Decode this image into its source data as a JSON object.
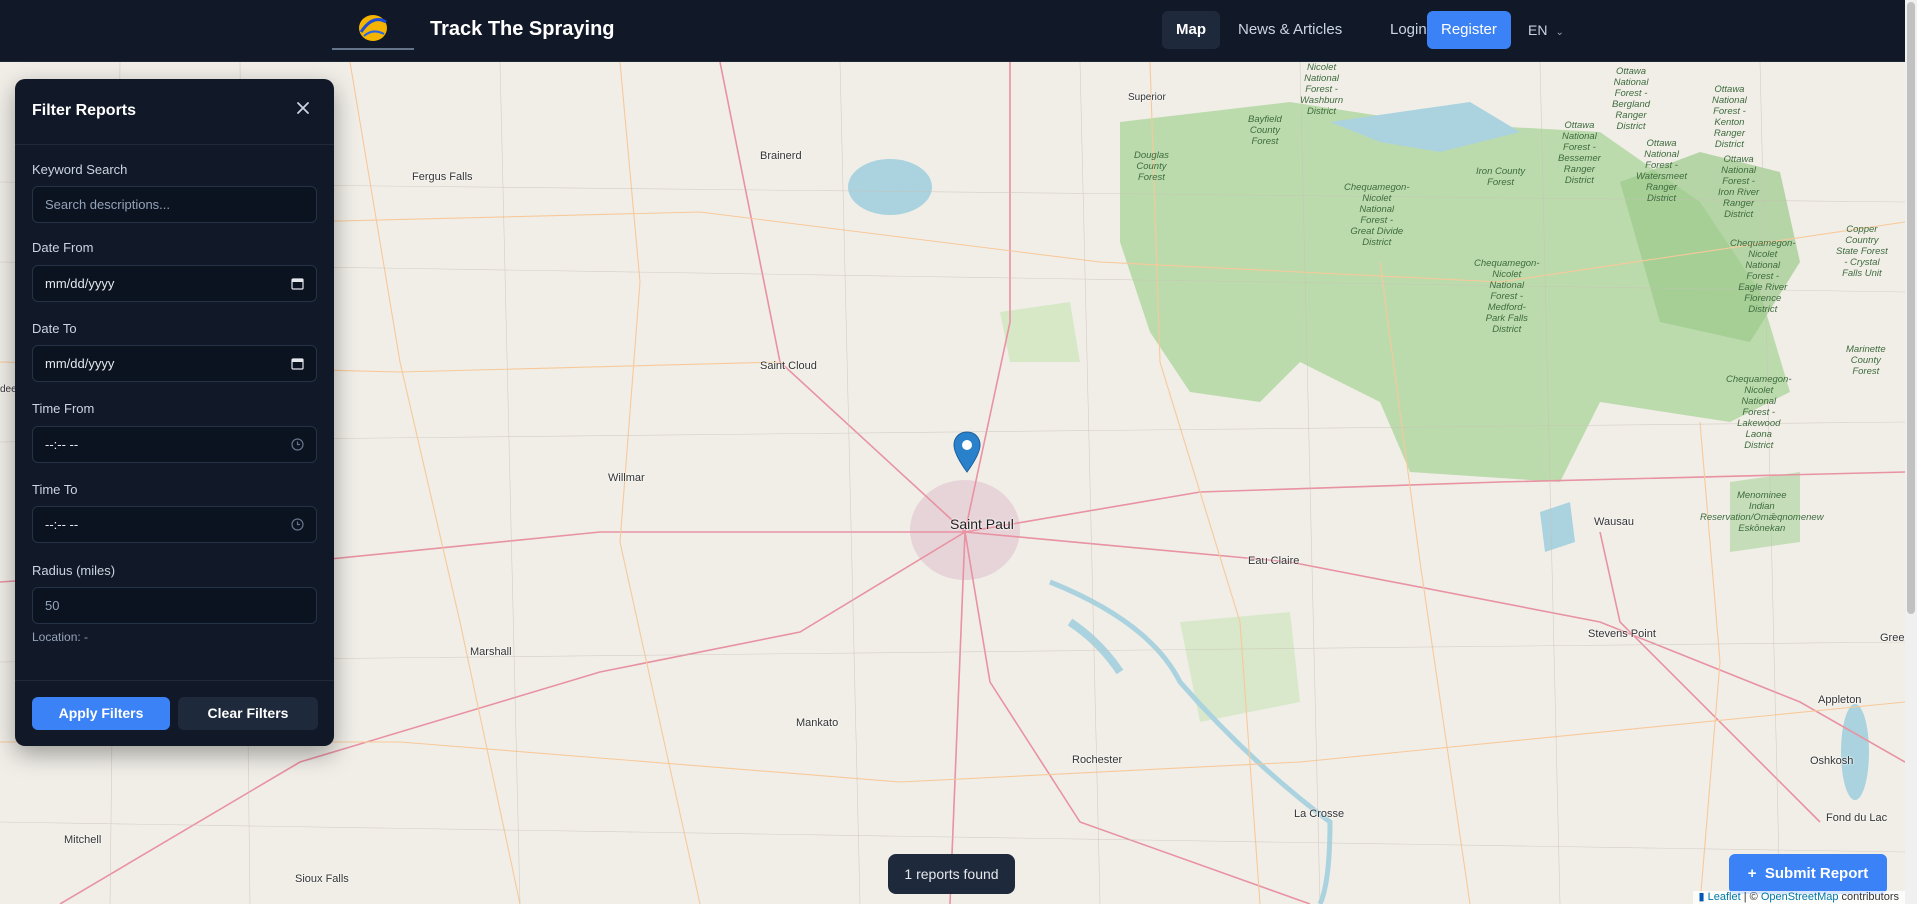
{
  "header": {
    "brand": "Track The Spraying",
    "nav": {
      "map": "Map",
      "news": "News & Articles",
      "login": "Login",
      "register": "Register",
      "lang": "EN"
    }
  },
  "filter": {
    "title": "Filter Reports",
    "keyword_label": "Keyword Search",
    "keyword_placeholder": "Search descriptions...",
    "date_from_label": "Date From",
    "date_from_value": "mm/dd/yyyy",
    "date_to_label": "Date To",
    "date_to_value": "mm/dd/yyyy",
    "time_from_label": "Time From",
    "time_from_value": "--:-- --",
    "time_to_label": "Time To",
    "time_to_value": "--:-- --",
    "radius_label": "Radius (miles)",
    "radius_placeholder": "50",
    "location": "Location: -",
    "apply": "Apply Filters",
    "clear": "Clear Filters"
  },
  "map": {
    "places": {
      "saint_paul": "Saint Paul",
      "brainerd": "Brainerd",
      "fergus_falls": "Fergus Falls",
      "saint_cloud": "Saint Cloud",
      "willmar": "Willmar",
      "marshall": "Marshall",
      "mankato": "Mankato",
      "rochester": "Rochester",
      "la_crosse": "La Crosse",
      "eau_claire": "Eau Claire",
      "wausau": "Wausau",
      "stevens_point": "Stevens Point",
      "appleton": "Appleton",
      "oshkosh": "Oshkosh",
      "fond_du_lac": "Fond du Lac",
      "mitchell": "Mitchell",
      "sioux_falls": "Sioux Falls",
      "superior": "Superior",
      "green_bay": "Gree",
      "aberdeen": "dee"
    },
    "forests": {
      "nicolet_washburn": "Nicolet\nNational\nForest -\nWashburn\nDistrict",
      "bayfield": "Bayfield\nCounty\nForest",
      "douglas": "Douglas\nCounty\nForest",
      "chequamegon_gd": "Chequamegon-\nNicolet\nNational\nForest -\nGreat Divide\nDistrict",
      "iron_county": "Iron County\nForest",
      "ottawa_bessemer": "Ottawa\nNational\nForest -\nBessemer\nRanger\nDistrict",
      "ottawa_bergland": "Ottawa\nNational\nForest -\nBergland\nRanger\nDistrict",
      "ottawa_watersmeet": "Ottawa\nNational\nForest -\nWatersmeet\nRanger\nDistrict",
      "ottawa_kenton": "Ottawa\nNational\nForest -\nKenton\nRanger\nDistrict",
      "ottawa_ironriver": "Ottawa\nNational\nForest -\nIron River\nRanger\nDistrict",
      "chequamegon_mf": "Chequamegon-\nNicolet\nNational\nForest -\nMedford-\nPark Falls\nDistrict",
      "chequamegon_er": "Chequamegon-\nNicolet\nNational\nForest -\nEagle River\nFlorence\nDistrict",
      "copper_country": "Copper\nCountry\nState Forest\n- Crystal\nFalls Unit",
      "marinette": "Marinette\nCounty\nForest",
      "chequamegon_ll": "Chequamegon-\nNicolet\nNational\nForest -\nLakewood\nLaona\nDistrict",
      "menominee": "Menominee\nIndian\nReservation/Omǣqnomenew\nEskōnekan"
    }
  },
  "reports_found": "1 reports found",
  "submit_report": "Submit Report",
  "attribution": {
    "leaflet": "Leaflet",
    "sep": " | © ",
    "osm": "OpenStreetMap",
    "tail": " contributors"
  }
}
